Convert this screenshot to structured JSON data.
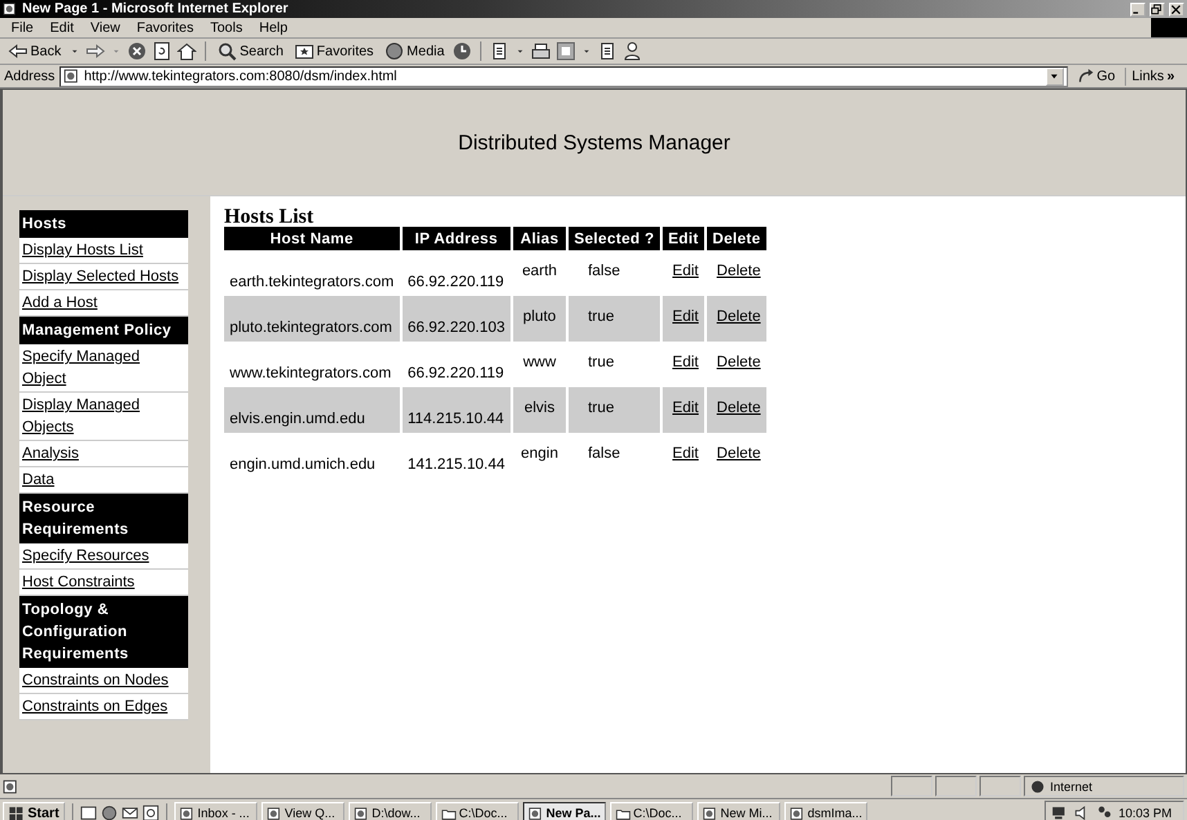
{
  "window": {
    "title": "New Page 1 - Microsoft Internet Explorer"
  },
  "menu": [
    "File",
    "Edit",
    "View",
    "Favorites",
    "Tools",
    "Help"
  ],
  "toolbar": {
    "back": "Back",
    "search": "Search",
    "favorites": "Favorites",
    "media": "Media"
  },
  "address_bar": {
    "label": "Address",
    "value": "http://www.tekintegrators.com:8080/dsm/index.html",
    "go": "Go",
    "links": "Links",
    "more": "»"
  },
  "page": {
    "title": "Distributed Systems Manager",
    "sidebar": [
      {
        "kind": "header",
        "text": "Hosts"
      },
      {
        "kind": "link",
        "text": "Display Hosts List"
      },
      {
        "kind": "link",
        "text": "Display Selected Hosts"
      },
      {
        "kind": "link",
        "text": "Add a Host"
      },
      {
        "kind": "header",
        "text": "Management Policy"
      },
      {
        "kind": "link",
        "text": "Specify Managed Object"
      },
      {
        "kind": "link",
        "text": "Display Managed Objects"
      },
      {
        "kind": "link",
        "text": "Analysis"
      },
      {
        "kind": "link",
        "text": "Data"
      },
      {
        "kind": "header",
        "text": "Resource Requirements"
      },
      {
        "kind": "link",
        "text": "Specify Resources"
      },
      {
        "kind": "link",
        "text": "Host Constraints"
      },
      {
        "kind": "header",
        "text": "Topology & Configuration Requirements"
      },
      {
        "kind": "link",
        "text": "Constraints on Nodes"
      },
      {
        "kind": "link",
        "text": "Constraints on Edges"
      }
    ],
    "heading": "Hosts List",
    "table": {
      "columns": [
        "Host Name",
        "IP Address",
        "Alias",
        "Selected ?",
        "Edit",
        "Delete"
      ],
      "rows": [
        {
          "host": "earth.tekintegrators.com",
          "ip": "66.92.220.119",
          "alias": "earth",
          "selected_text": "false",
          "edit": "Edit",
          "delete": "Delete"
        },
        {
          "host": "pluto.tekintegrators.com",
          "ip": "66.92.220.103",
          "alias": "pluto",
          "selected_text": "true",
          "edit": "Edit",
          "delete": "Delete"
        },
        {
          "host": "www.tekintegrators.com",
          "ip": "66.92.220.119",
          "alias": "www",
          "selected_text": "true",
          "edit": "Edit",
          "delete": "Delete"
        },
        {
          "host": "elvis.engin.umd.edu",
          "ip": "114.215.10.44",
          "alias": "elvis",
          "selected_text": "true",
          "edit": "Edit",
          "delete": "Delete"
        },
        {
          "host": "engin.umd.umich.edu",
          "ip": "141.215.10.44",
          "alias": "engin",
          "selected_text": "false",
          "edit": "Edit",
          "delete": "Delete"
        }
      ]
    }
  },
  "status_bar": {
    "zone": "Internet"
  },
  "taskbar": {
    "start": "Start",
    "tasks": [
      {
        "label": "Inbox - ...",
        "selected": false
      },
      {
        "label": "View Q...",
        "selected": false
      },
      {
        "label": "D:\\dow...",
        "selected": false
      },
      {
        "label": "C:\\Doc...",
        "selected": false
      },
      {
        "label": "New Pa...",
        "selected": true
      },
      {
        "label": "C:\\Doc...",
        "selected": false
      },
      {
        "label": "New Mi...",
        "selected": false
      },
      {
        "label": "dsmIma...",
        "selected": false
      }
    ],
    "clock": "10:03 PM"
  }
}
